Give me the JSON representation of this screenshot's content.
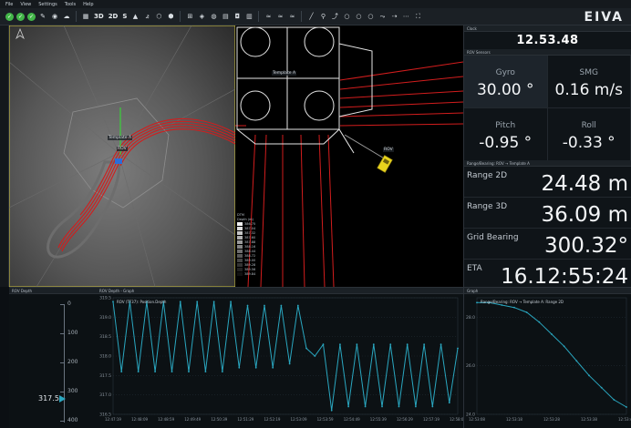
{
  "menu": {
    "items": [
      "File",
      "View",
      "Settings",
      "Tools",
      "Help"
    ]
  },
  "toolbar": {
    "view3d": "3D",
    "view2d": "2D",
    "viewS": "S"
  },
  "brand": "EIVA",
  "map": {
    "template_label": "Template A",
    "rov_label": "ROV",
    "legend_title": "DTM\nDepth (m)",
    "legend_values": [
      "386.75",
      "387.04",
      "387.32",
      "387.60",
      "387.88",
      "388.16",
      "388.44",
      "388.72",
      "389.00",
      "389.28",
      "389.56",
      "389.84"
    ]
  },
  "clock": {
    "title": "Clock",
    "time": "12.53.48"
  },
  "sensors": {
    "title": "ROV Sensors",
    "items": [
      {
        "label": "Gyro",
        "value": "30.00 °"
      },
      {
        "label": "SMG",
        "value": "0.16 m/s"
      },
      {
        "label": "Pitch",
        "value": "-0.95 °"
      },
      {
        "label": "Roll",
        "value": "-0.33 °"
      }
    ]
  },
  "range_panel": {
    "title": "Range/Bearing: ROV → Template A",
    "rows": [
      {
        "label": "Range 2D",
        "value": "24.48 m"
      },
      {
        "label": "Range 3D",
        "value": "36.09 m"
      },
      {
        "label": "Grid Bearing",
        "value": "300.32°"
      },
      {
        "label": "ETA",
        "value": "16.12:55:24"
      }
    ]
  },
  "rov_depth": {
    "title": "ROV Depth",
    "scale": [
      "0",
      "100",
      "200",
      "300",
      "400"
    ],
    "current": "317.5"
  },
  "depth_graph": {
    "title": "ROV Depth - Graph",
    "legend": "ROV (TF37): Position.Depth",
    "y_ticks": [
      "319.5",
      "319.0",
      "318.5",
      "318.0",
      "317.5",
      "317.0",
      "316.5"
    ],
    "x_ticks": [
      "12:47:19",
      "12:48:09",
      "12:48:59",
      "12:49:49",
      "12:50:39",
      "12:51:29",
      "12:52:19",
      "12:53:09",
      "12:53:59",
      "12:54:49",
      "12:55:39",
      "12:56:29",
      "12:57:19",
      "12:58:09"
    ]
  },
  "range_graph": {
    "title": "Graph",
    "legend": "Range/Bearing: ROV → Template A: Range 2D",
    "y_ticks": [
      "28.0",
      "26.0",
      "24.0"
    ],
    "x_ticks": [
      "12:53:08",
      "12:53:18",
      "12:53:28",
      "12:53:38",
      "12:53:48"
    ]
  },
  "colors": {
    "accent": "#2aa7c0",
    "route": "#d21d1d",
    "panel": "#0f1418"
  },
  "chart_data": [
    {
      "type": "line",
      "title": "ROV Depth - Graph",
      "series": [
        {
          "name": "ROV (TF37): Position.Depth",
          "values": [
            319.4,
            317.6,
            319.4,
            317.6,
            319.4,
            317.6,
            319.4,
            317.6,
            319.4,
            317.6,
            319.4,
            317.6,
            319.4,
            317.6,
            319.4,
            317.7,
            319.3,
            317.7,
            319.3,
            317.7,
            319.3,
            317.8,
            319.3,
            318.2,
            318.0,
            318.3,
            316.6,
            318.3,
            316.7,
            318.3,
            316.7,
            318.3,
            316.7,
            318.3,
            316.7,
            318.3,
            316.7,
            318.3,
            316.7,
            318.3,
            316.8,
            318.2
          ]
        }
      ],
      "ylim": [
        316.5,
        319.5
      ]
    },
    {
      "type": "line",
      "title": "Graph",
      "series": [
        {
          "name": "Range/Bearing: ROV → Template A: Range 2D",
          "values": [
            28.6,
            28.6,
            28.5,
            28.4,
            28.2,
            27.8,
            27.3,
            26.8,
            26.2,
            25.6,
            25.1,
            24.6,
            24.3
          ]
        }
      ],
      "ylim": [
        24.0,
        28.8
      ]
    }
  ]
}
